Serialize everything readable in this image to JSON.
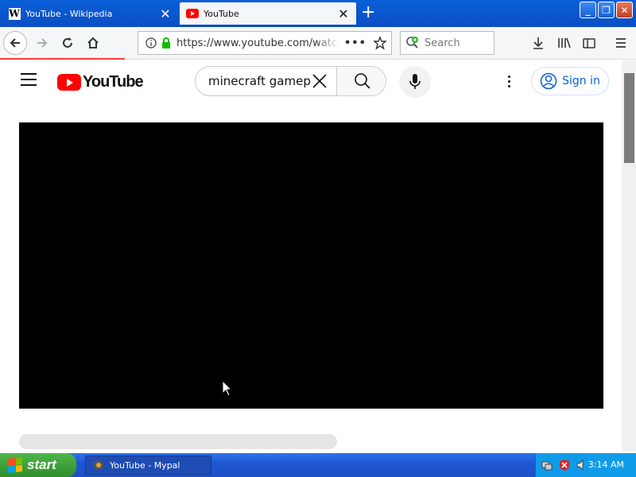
{
  "browser": {
    "tabs": [
      {
        "title": "YouTube - Wikipedia",
        "favicon": "wikipedia-icon",
        "active": false
      },
      {
        "title": "YouTube",
        "favicon": "youtube-icon",
        "active": true
      }
    ],
    "url": "https://www.youtube.com/watch",
    "search_placeholder": "Search",
    "accent_color": "#0a5fd8"
  },
  "youtube": {
    "logo_text": "YouTube",
    "search_query": "minecraft gameplay",
    "sign_in_label": "Sign in",
    "brand_color": "#ff0000",
    "link_color": "#065fd4"
  },
  "taskbar": {
    "start_label": "start",
    "task_item_label": "YouTube - Mypal",
    "clock": "3:14 AM"
  }
}
